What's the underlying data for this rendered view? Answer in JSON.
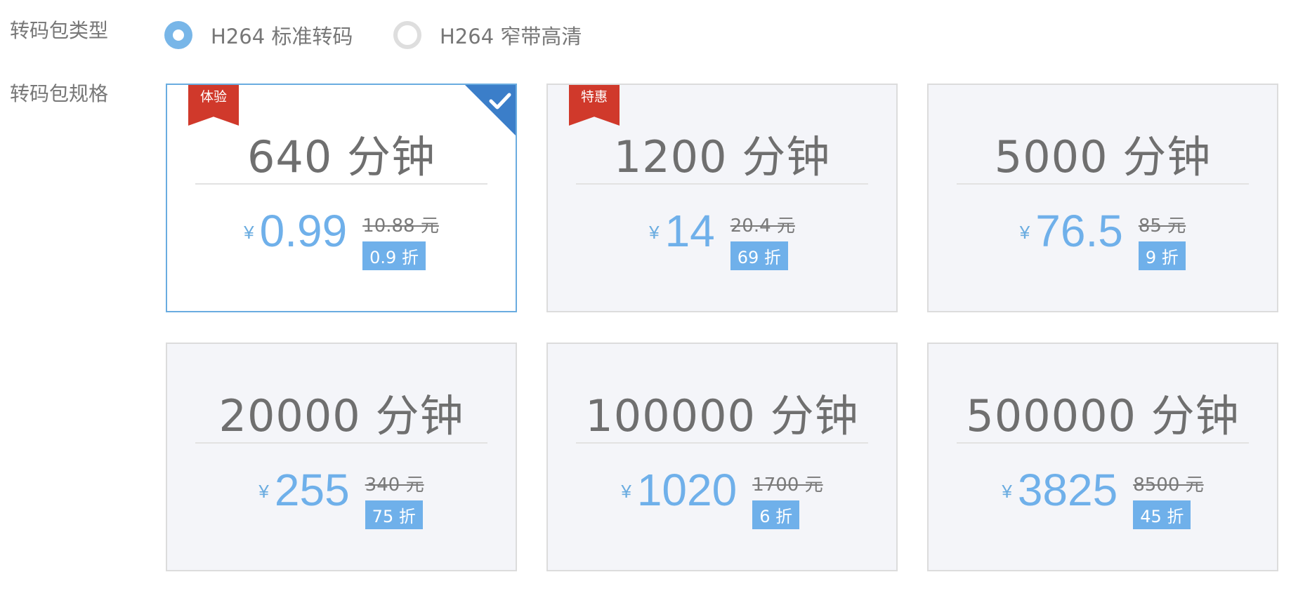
{
  "type_label": "转码包类型",
  "spec_label": "转码包规格",
  "types": [
    {
      "label": "H264 标准转码",
      "selected": true
    },
    {
      "label": "H264 窄带高清",
      "selected": false
    }
  ],
  "currency": "¥",
  "packages": [
    {
      "minutes": "640 分钟",
      "price": "0.99",
      "original": "10.88 元",
      "discount": "0.9 折",
      "badge": "体验",
      "selected": true,
      "check_icon": "check-icon"
    },
    {
      "minutes": "1200 分钟",
      "price": "14",
      "original": "20.4 元",
      "discount": "69 折",
      "badge": "特惠",
      "selected": false
    },
    {
      "minutes": "5000 分钟",
      "price": "76.5",
      "original": "85 元",
      "discount": "9 折",
      "badge": "",
      "selected": false
    },
    {
      "minutes": "20000 分钟",
      "price": "255",
      "original": "340 元",
      "discount": "75 折",
      "badge": "",
      "selected": false
    },
    {
      "minutes": "100000 分钟",
      "price": "1020",
      "original": "1700 元",
      "discount": "6 折",
      "badge": "",
      "selected": false
    },
    {
      "minutes": "500000 分钟",
      "price": "3825",
      "original": "8500 元",
      "discount": "45 折",
      "badge": "",
      "selected": false
    }
  ],
  "colors": {
    "accent": "#6fb0ea",
    "badge": "#d0392b",
    "check_corner": "#3b7ec9"
  }
}
